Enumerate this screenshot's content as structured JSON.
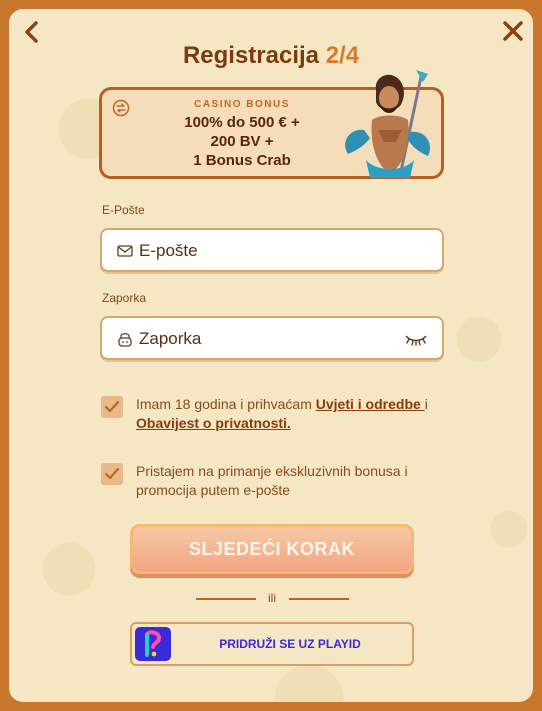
{
  "header": {
    "title": "Registracija",
    "step": "2/4"
  },
  "bonus": {
    "label": "CASINO BONUS",
    "line1": "100% do 500 € +",
    "line2": "200 BV +",
    "line3": "1 Bonus Crab"
  },
  "email": {
    "label": "E-Pošte",
    "placeholder": "E-pošte"
  },
  "password": {
    "label": "Zaporka",
    "placeholder": "Zaporka"
  },
  "consent_age": {
    "text_before": "Imam 18 godina i prihvaćam ",
    "link_terms": "Uvjeti i odredbe ",
    "text_mid": "i ",
    "link_privacy": "Obavijest o privatnosti."
  },
  "consent_marketing": {
    "text": "Pristajem na primanje ekskluzivnih bonusa i promocija putem e-pošte"
  },
  "cta": {
    "label": "SLJEDEĆI KORAK"
  },
  "divider": {
    "text": "ili"
  },
  "playid": {
    "label": "PRIDRUŽI SE UZ PLAYID"
  },
  "colors": {
    "accent": "#d97a2b",
    "brown": "#7a3a12",
    "frame": "#c8772c",
    "panel": "#f6e7c4",
    "playid": "#3a2ad8"
  }
}
